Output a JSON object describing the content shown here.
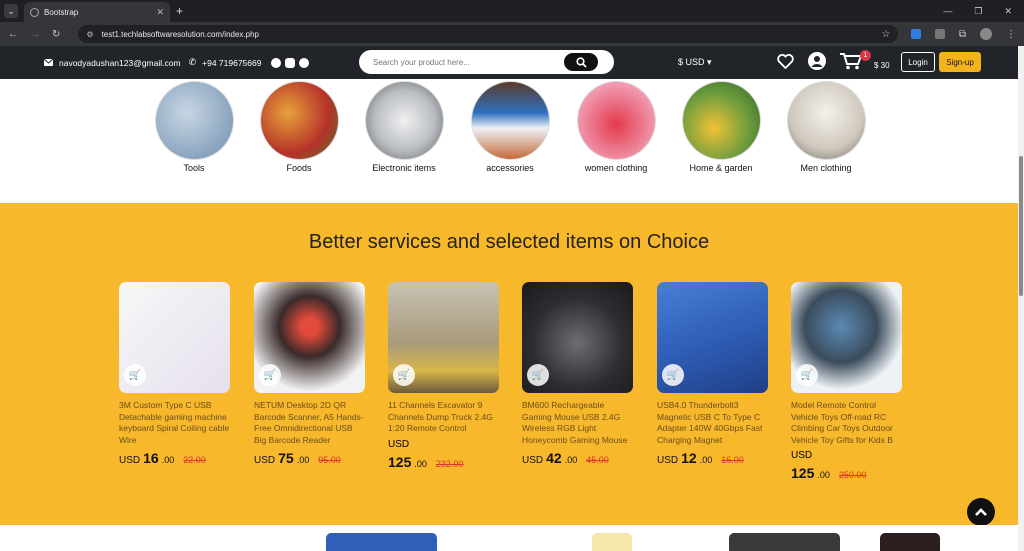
{
  "browser": {
    "tab_title": "Bootstrap",
    "url": "test1.techlabsoftwaresolution.com/index.php"
  },
  "navbar": {
    "email": "navodyadushan123@gmail.com",
    "phone": "+94 719675669",
    "search_placeholder": "Search your product here...",
    "currency": "$ USD",
    "cart_count": "1",
    "cart_total": "$ 30",
    "login_label": "Login",
    "signup_label": "Sign-up"
  },
  "categories": [
    {
      "label": "Tools",
      "color": "#8fb0cc"
    },
    {
      "label": "Foods",
      "color": "#c0422e"
    },
    {
      "label": "Electronic items",
      "color": "#cfd2d6"
    },
    {
      "label": "accessories",
      "color": "#b98a5c"
    },
    {
      "label": "women clothing",
      "color": "#d8406a"
    },
    {
      "label": "Home & garden",
      "color": "#7da34a"
    },
    {
      "label": "Men clothing",
      "color": "#d9d4cc"
    }
  ],
  "choice": {
    "title": "Better services and selected items on Choice",
    "products": [
      {
        "name": "3M Custom Type C USB Detachable gaming machine keyboard Spiral Coiling cable Wire",
        "currency": "USD",
        "price": "16",
        "cents": ".00",
        "old_price": "22.00",
        "img_color": "#f2f2f2"
      },
      {
        "name": "NETUM Desktop 2D QR Barcode Scanner, A5 Hands-Free Omnidirectional USB Big Barcode Reader",
        "currency": "USD",
        "price": "75",
        "cents": ".00",
        "old_price": "95.00",
        "img_color": "#3a2a2a"
      },
      {
        "name": "11 Channels Excavator 9 Channels Dump Truck 2.4G 1:20 Remote Control",
        "currency": "USD",
        "price": "125",
        "cents": ".00",
        "old_price": "232.00",
        "img_color": "#a89a7c"
      },
      {
        "name": "BM600 Rechargeable Gaming Mouse USB 2.4G Wireless RGB Light Honeycomb Gaming Mouse",
        "currency": "USD",
        "price": "42",
        "cents": ".00",
        "old_price": "45.00",
        "img_color": "#2d2d31"
      },
      {
        "name": "USB4.0 Thunderbolt3 Magnetic USB C To Type C Adapter 140W 40Gbps Fast Charging Magnet",
        "currency": "USD",
        "price": "12",
        "cents": ".00",
        "old_price": "16.00",
        "img_color": "#2f5fb8"
      },
      {
        "name": "Model Remote Control Vehicle Toys Off-road RC Climbing Car Toys Outdoor Vehicle Toy Gifts for Kids B",
        "currency": "USD",
        "price": "125",
        "cents": ".00",
        "old_price": "250.00",
        "img_color": "#eef1f5"
      }
    ]
  }
}
